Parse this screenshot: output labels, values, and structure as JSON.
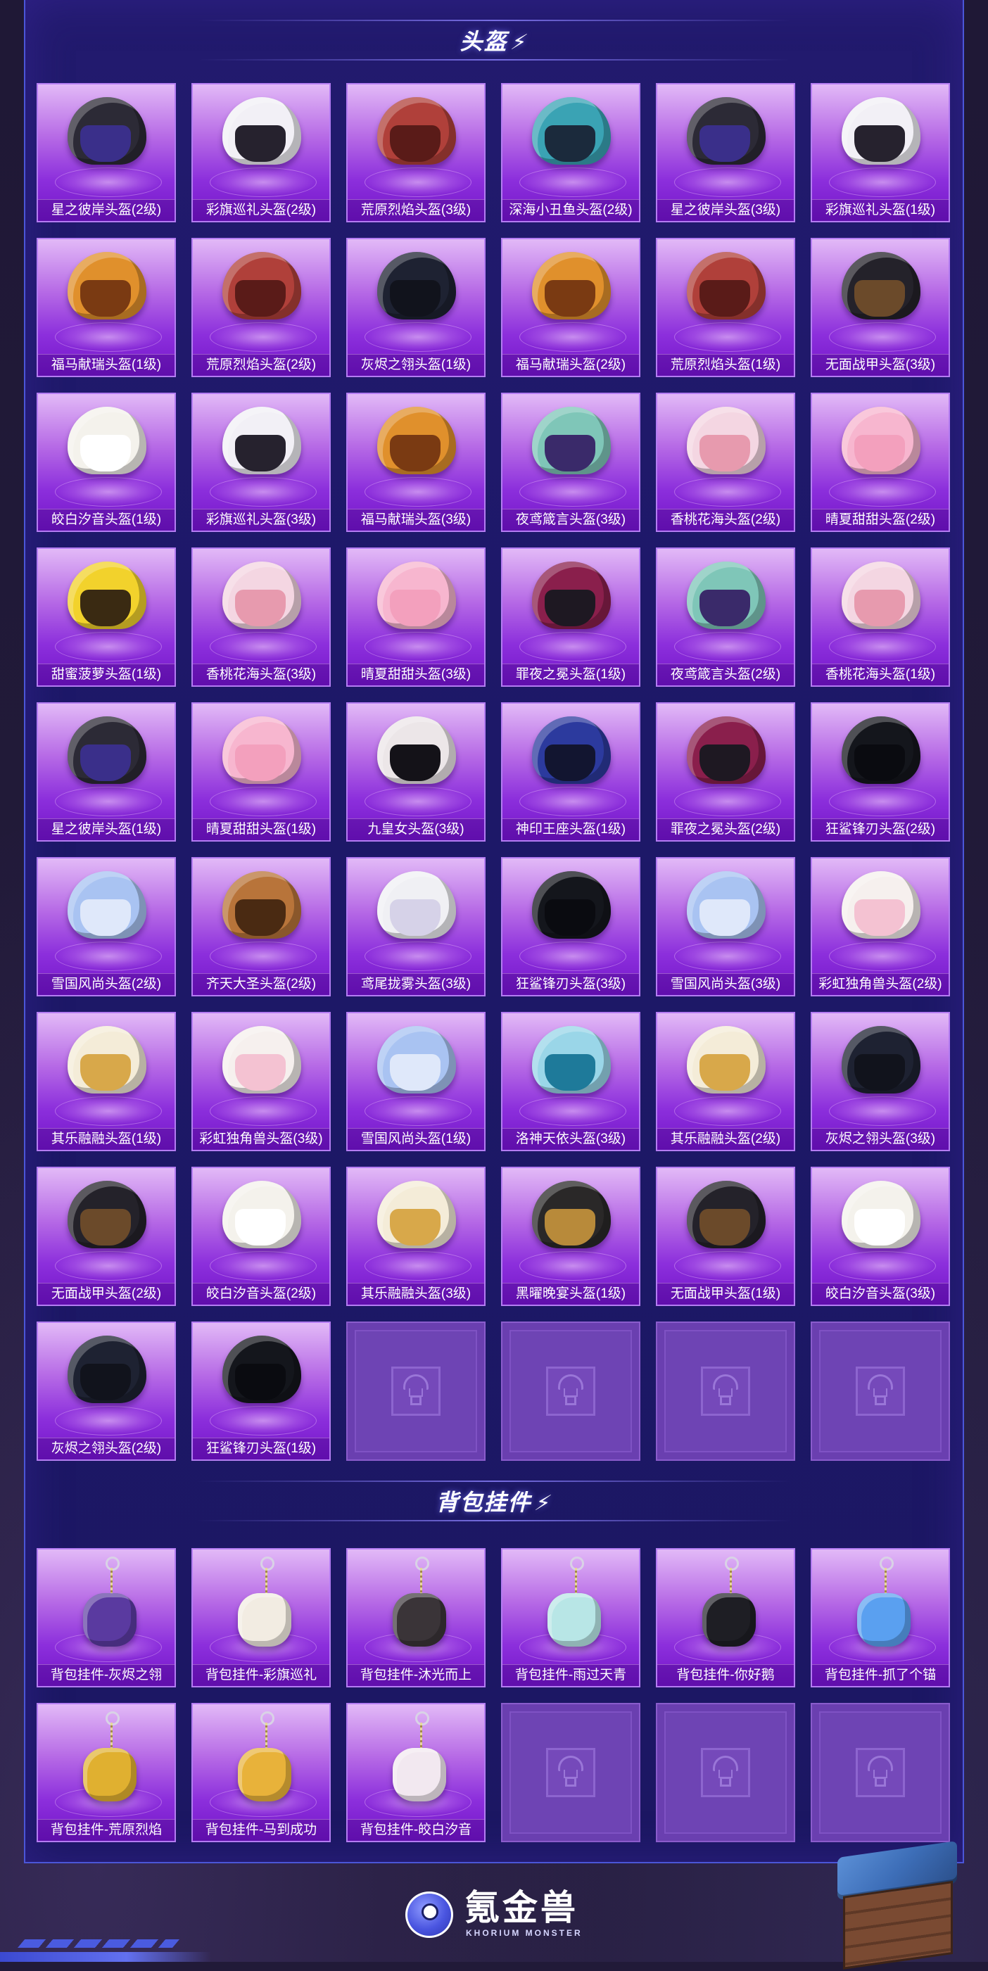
{
  "sections": {
    "helmets_title": "头盔",
    "charms_title": "背包挂件"
  },
  "helmets": [
    {
      "label": "星之彼岸头盔(2级)",
      "color": "#2c2a36",
      "visor": "#3a2f8a",
      "icon": "helmet-icon"
    },
    {
      "label": "彩旗巡礼头盔(2级)",
      "color": "#f2f0f6",
      "visor": "#26222e",
      "icon": "helmet-icon"
    },
    {
      "label": "荒原烈焰头盔(3级)",
      "color": "#b0403a",
      "visor": "#5a1b18",
      "icon": "helmet-icon"
    },
    {
      "label": "深海小丑鱼头盔(2级)",
      "color": "#3aa3b4",
      "visor": "#1b2a3c",
      "icon": "helmet-icon"
    },
    {
      "label": "星之彼岸头盔(3级)",
      "color": "#2c2a36",
      "visor": "#3a2f8a",
      "icon": "helmet-icon"
    },
    {
      "label": "彩旗巡礼头盔(1级)",
      "color": "#f2f0f6",
      "visor": "#26222e",
      "icon": "helmet-icon"
    },
    {
      "label": "福马献瑞头盔(1级)",
      "color": "#e0902c",
      "visor": "#7a3a12",
      "icon": "helmet-icon"
    },
    {
      "label": "荒原烈焰头盔(2级)",
      "color": "#b0403a",
      "visor": "#5a1b18",
      "icon": "helmet-icon"
    },
    {
      "label": "灰烬之翎头盔(1级)",
      "color": "#1e2232",
      "visor": "#11131c",
      "icon": "helmet-icon"
    },
    {
      "label": "福马献瑞头盔(2级)",
      "color": "#e0902c",
      "visor": "#7a3a12",
      "icon": "helmet-icon"
    },
    {
      "label": "荒原烈焰头盔(1级)",
      "color": "#b0403a",
      "visor": "#5a1b18",
      "icon": "helmet-icon"
    },
    {
      "label": "无面战甲头盔(3级)",
      "color": "#24222a",
      "visor": "#6b4a2a",
      "icon": "helmet-icon"
    },
    {
      "label": "皎白汐音头盔(1级)",
      "color": "#f4f2ec",
      "visor": "#ffffff",
      "icon": "helmet-icon"
    },
    {
      "label": "彩旗巡礼头盔(3级)",
      "color": "#f2f0f6",
      "visor": "#26222e",
      "icon": "helmet-icon"
    },
    {
      "label": "福马献瑞头盔(3级)",
      "color": "#e0902c",
      "visor": "#7a3a12",
      "icon": "helmet-icon"
    },
    {
      "label": "夜鸢箴言头盔(3级)",
      "color": "#7fc6b8",
      "visor": "#3a2a6a",
      "icon": "helmet-icon"
    },
    {
      "label": "香桃花海头盔(2级)",
      "color": "#f4d6e2",
      "visor": "#e79aae",
      "icon": "helmet-icon"
    },
    {
      "label": "晴夏甜甜头盔(2级)",
      "color": "#f7b6cf",
      "visor": "#f3a0bd",
      "icon": "helmet-icon"
    },
    {
      "label": "甜蜜菠萝头盔(1级)",
      "color": "#f2d22c",
      "visor": "#3a2a12",
      "icon": "helmet-icon"
    },
    {
      "label": "香桃花海头盔(3级)",
      "color": "#f4d6e2",
      "visor": "#e79aae",
      "icon": "helmet-icon"
    },
    {
      "label": "晴夏甜甜头盔(3级)",
      "color": "#f7b6cf",
      "visor": "#f3a0bd",
      "icon": "helmet-icon"
    },
    {
      "label": "罪夜之冕头盔(1级)",
      "color": "#8a1f4c",
      "visor": "#1e1822",
      "icon": "helmet-icon"
    },
    {
      "label": "夜鸢箴言头盔(2级)",
      "color": "#7fc6b8",
      "visor": "#3a2a6a",
      "icon": "helmet-icon"
    },
    {
      "label": "香桃花海头盔(1级)",
      "color": "#f4d6e2",
      "visor": "#e79aae",
      "icon": "helmet-icon"
    },
    {
      "label": "星之彼岸头盔(1级)",
      "color": "#2c2a36",
      "visor": "#3a2f8a",
      "icon": "helmet-icon"
    },
    {
      "label": "晴夏甜甜头盔(1级)",
      "color": "#f7b6cf",
      "visor": "#f3a0bd",
      "icon": "helmet-icon"
    },
    {
      "label": "九皇女头盔(3级)",
      "color": "#ece6e8",
      "visor": "#141218",
      "icon": "helmet-icon"
    },
    {
      "label": "神印王座头盔(1级)",
      "color": "#2c3a9e",
      "visor": "#121530",
      "icon": "helmet-icon"
    },
    {
      "label": "罪夜之冕头盔(2级)",
      "color": "#8a1f4c",
      "visor": "#1e1822",
      "icon": "helmet-icon"
    },
    {
      "label": "狂鲨锋刃头盔(2级)",
      "color": "#14161c",
      "visor": "#0a0b10",
      "icon": "helmet-icon"
    },
    {
      "label": "雪国风尚头盔(2级)",
      "color": "#a9c3f2",
      "visor": "#dfe8fa",
      "icon": "helmet-icon"
    },
    {
      "label": "齐天大圣头盔(2级)",
      "color": "#b8743a",
      "visor": "#4a2a12",
      "icon": "helmet-icon"
    },
    {
      "label": "鸢尾拢雾头盔(3级)",
      "color": "#f0f0f4",
      "visor": "#d6d2e8",
      "icon": "helmet-icon"
    },
    {
      "label": "狂鲨锋刃头盔(3级)",
      "color": "#14161c",
      "visor": "#0a0b10",
      "icon": "helmet-icon"
    },
    {
      "label": "雪国风尚头盔(3级)",
      "color": "#a9c3f2",
      "visor": "#dfe8fa",
      "icon": "helmet-icon"
    },
    {
      "label": "彩虹独角兽头盔(2级)",
      "color": "#f6f0ee",
      "visor": "#f4c2d2",
      "icon": "helmet-icon"
    },
    {
      "label": "其乐融融头盔(1级)",
      "color": "#f4ecd8",
      "visor": "#d8a84a",
      "icon": "helmet-icon"
    },
    {
      "label": "彩虹独角兽头盔(3级)",
      "color": "#f6f0ee",
      "visor": "#f4c2d2",
      "icon": "helmet-icon"
    },
    {
      "label": "雪国风尚头盔(1级)",
      "color": "#a9c3f2",
      "visor": "#dfe8fa",
      "icon": "helmet-icon"
    },
    {
      "label": "洛神天依头盔(3级)",
      "color": "#9ad6e8",
      "visor": "#1e7a9a",
      "icon": "helmet-icon"
    },
    {
      "label": "其乐融融头盔(2级)",
      "color": "#f4ecd8",
      "visor": "#d8a84a",
      "icon": "helmet-icon"
    },
    {
      "label": "灰烬之翎头盔(3级)",
      "color": "#1e2232",
      "visor": "#11131c",
      "icon": "helmet-icon"
    },
    {
      "label": "无面战甲头盔(2级)",
      "color": "#24222a",
      "visor": "#6b4a2a",
      "icon": "helmet-icon"
    },
    {
      "label": "皎白汐音头盔(2级)",
      "color": "#f4f2ec",
      "visor": "#ffffff",
      "icon": "helmet-icon"
    },
    {
      "label": "其乐融融头盔(3级)",
      "color": "#f4ecd8",
      "visor": "#d8a84a",
      "icon": "helmet-icon"
    },
    {
      "label": "黑曜晚宴头盔(1级)",
      "color": "#2a2828",
      "visor": "#b88a3a",
      "icon": "helmet-icon"
    },
    {
      "label": "无面战甲头盔(1级)",
      "color": "#24222a",
      "visor": "#6b4a2a",
      "icon": "helmet-icon"
    },
    {
      "label": "皎白汐音头盔(3级)",
      "color": "#f4f2ec",
      "visor": "#ffffff",
      "icon": "helmet-icon"
    },
    {
      "label": "灰烬之翎头盔(2级)",
      "color": "#1e2232",
      "visor": "#11131c",
      "icon": "helmet-icon"
    },
    {
      "label": "狂鲨锋刃头盔(1级)",
      "color": "#14161c",
      "visor": "#0a0b10",
      "icon": "helmet-icon"
    }
  ],
  "charms": [
    {
      "label": "背包挂件-灰烬之翎",
      "color": "#5a3aa0",
      "icon": "charm-icon"
    },
    {
      "label": "背包挂件-彩旗巡礼",
      "color": "#f2ece2",
      "icon": "charm-icon"
    },
    {
      "label": "背包挂件-沐光而上",
      "color": "#3a3438",
      "icon": "charm-icon"
    },
    {
      "label": "背包挂件-雨过天青",
      "color": "#b8e6e6",
      "icon": "charm-icon"
    },
    {
      "label": "背包挂件-你好鹅",
      "color": "#1e1e24",
      "icon": "charm-icon"
    },
    {
      "label": "背包挂件-抓了个锚",
      "color": "#5aa0f0",
      "icon": "charm-icon"
    },
    {
      "label": "背包挂件-荒原烈焰",
      "color": "#e0b030",
      "icon": "charm-icon"
    },
    {
      "label": "背包挂件-马到成功",
      "color": "#e8b23a",
      "icon": "charm-icon"
    },
    {
      "label": "背包挂件-皎白汐音",
      "color": "#f2e8f0",
      "icon": "charm-icon"
    }
  ],
  "empty_slots": {
    "helmets": 4,
    "charms": 3,
    "icon": "airdrop-crate-icon"
  },
  "brand": {
    "name": "氪金兽",
    "subtitle": "KHORIUM MONSTER",
    "icon": "mascot-icon"
  },
  "colors": {
    "panel": "#1d1868",
    "card_top": "#e2b9f7",
    "card_bottom": "#7416c9",
    "empty_card": "#6a3fb0",
    "accent": "#4b56d8"
  }
}
